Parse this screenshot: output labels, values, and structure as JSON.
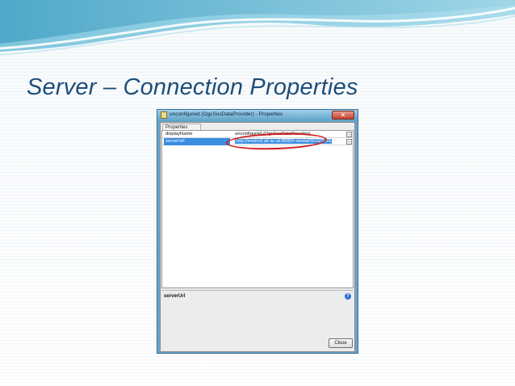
{
  "slide": {
    "title": "Server – Connection Properties"
  },
  "window": {
    "title": "unconfigured (OgcSosDataProvider) - Properties",
    "close_glyph": "×",
    "tab_label": "Properties",
    "properties": [
      {
        "name": "displayName",
        "value": "unconfigured (OgcSosDataProvider)",
        "selected": false
      },
      {
        "name": "serverUrl",
        "value": "http://envirs3.ait.ac.at:8080/r-wedat/SOS/SOS",
        "selected": true
      }
    ],
    "ellipsis_label": "...",
    "help_property_name": "serverUrl",
    "help_glyph": "?",
    "close_button_label": "Close"
  },
  "colors": {
    "title_text": "#1f4e79",
    "selection": "#3a8de0",
    "highlight_ring": "#d21a1a"
  }
}
